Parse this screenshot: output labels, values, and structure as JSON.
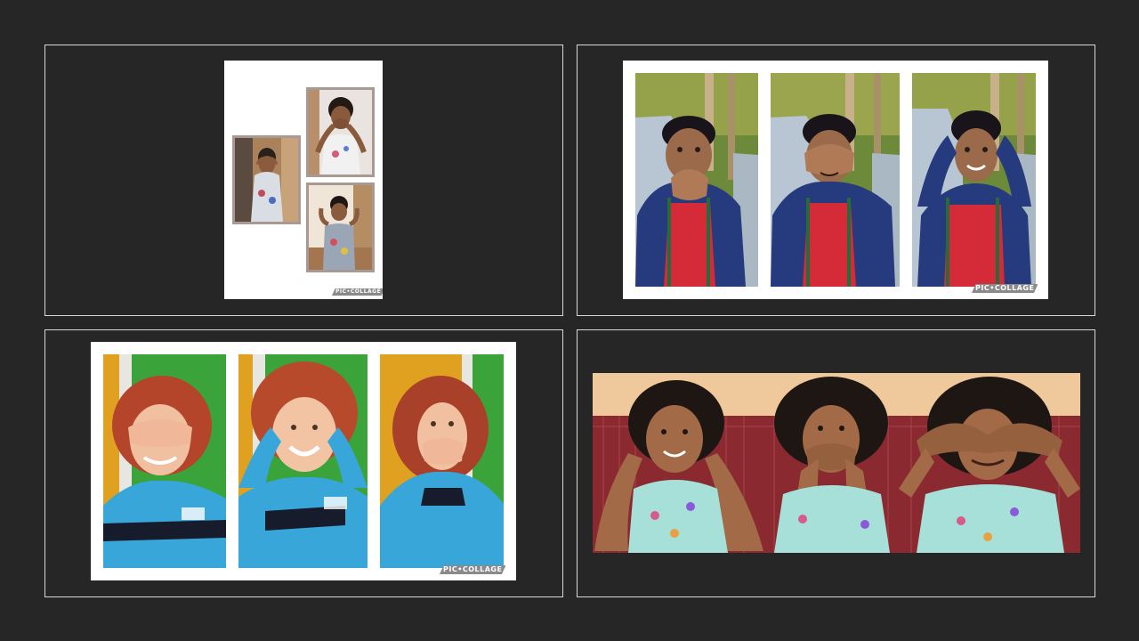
{
  "slides": [
    {
      "watermark": "PIC•COLLAGE",
      "photos": [
        {
          "pose": "covering eyes",
          "icon": "child-photo"
        },
        {
          "pose": "covering mouth",
          "icon": "child-photo"
        },
        {
          "pose": "covering ears",
          "icon": "child-photo"
        }
      ]
    },
    {
      "watermark": "PIC•COLLAGE",
      "photos": [
        {
          "pose": "covering mouth",
          "icon": "child-photo"
        },
        {
          "pose": "covering eyes",
          "icon": "child-photo"
        },
        {
          "pose": "covering ears",
          "icon": "child-photo"
        }
      ]
    },
    {
      "watermark": "PIC•COLLAGE",
      "photos": [
        {
          "pose": "covering eyes",
          "icon": "child-photo"
        },
        {
          "pose": "covering ears",
          "icon": "child-photo"
        },
        {
          "pose": "covering mouth",
          "icon": "child-photo"
        }
      ]
    },
    {
      "photos": [
        {
          "pose": "covering ears",
          "icon": "child-photo"
        },
        {
          "pose": "covering mouth",
          "icon": "child-photo"
        },
        {
          "pose": "covering eyes",
          "icon": "child-photo"
        }
      ]
    }
  ],
  "colors": {
    "background": "#262626",
    "border": "#d9d9d9",
    "collage_bg": "#ffffff",
    "watermark_bg": "#8a8a8a"
  }
}
